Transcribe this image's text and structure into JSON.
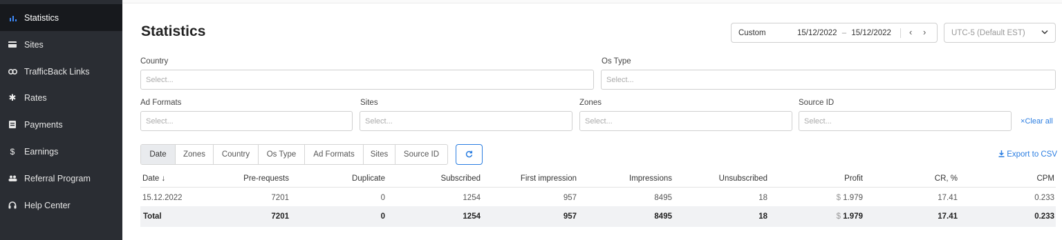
{
  "sidebar": {
    "items": [
      {
        "label": "Statistics",
        "icon": "bar-chart-icon"
      },
      {
        "label": "Sites",
        "icon": "card-icon"
      },
      {
        "label": "TrafficBack Links",
        "icon": "link-icon"
      },
      {
        "label": "Rates",
        "icon": "gear-icon"
      },
      {
        "label": "Payments",
        "icon": "document-icon"
      },
      {
        "label": "Earnings",
        "icon": "dollar-icon"
      },
      {
        "label": "Referral Program",
        "icon": "users-icon"
      },
      {
        "label": "Help Center",
        "icon": "headset-icon"
      }
    ]
  },
  "page": {
    "title": "Statistics"
  },
  "date_range": {
    "preset": "Custom",
    "start": "15/12/2022",
    "separator": "–",
    "end": "15/12/2022"
  },
  "timezone": {
    "value": "UTC-5 (Default EST)"
  },
  "filters": {
    "country": {
      "label": "Country",
      "placeholder": "Select..."
    },
    "os_type": {
      "label": "Os Type",
      "placeholder": "Select..."
    },
    "ad_formats": {
      "label": "Ad Formats",
      "placeholder": "Select..."
    },
    "sites": {
      "label": "Sites",
      "placeholder": "Select..."
    },
    "zones": {
      "label": "Zones",
      "placeholder": "Select..."
    },
    "source_id": {
      "label": "Source ID",
      "placeholder": "Select..."
    },
    "clear_all": "Clear all"
  },
  "group_tabs": [
    "Date",
    "Zones",
    "Country",
    "Os Type",
    "Ad Formats",
    "Sites",
    "Source ID"
  ],
  "export_label": "Export to CSV",
  "table": {
    "headers": [
      "Date",
      "Pre-requests",
      "Duplicate",
      "Subscribed",
      "First impression",
      "Impressions",
      "Unsubscribed",
      "Profit",
      "CR, %",
      "CPM"
    ],
    "sort_indicator": "↓",
    "rows": [
      [
        "15.12.2022",
        "7201",
        "0",
        "1254",
        "957",
        "8495",
        "18",
        "1.979",
        "17.41",
        "0.233"
      ]
    ],
    "total": [
      "Total",
      "7201",
      "0",
      "1254",
      "957",
      "8495",
      "18",
      "1.979",
      "17.41",
      "0.233"
    ],
    "currency_symbol": "$"
  },
  "colors": {
    "accent": "#2a7de1",
    "sidebar_bg": "#2a2d33",
    "sidebar_active_bg": "#17191d"
  }
}
